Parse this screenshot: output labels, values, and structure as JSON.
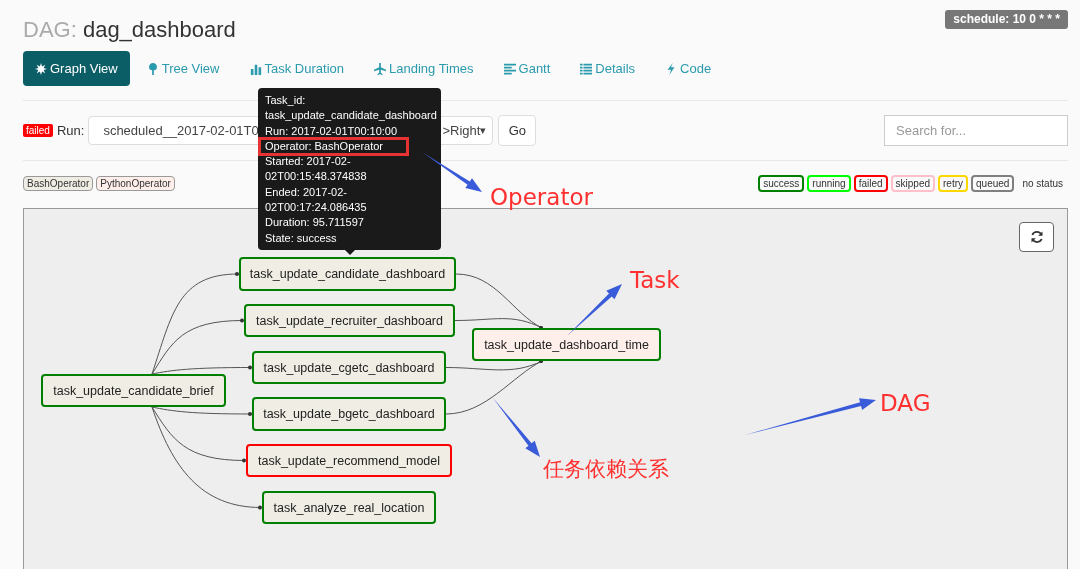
{
  "title": {
    "prefix": "DAG:",
    "name": "dag_dashboard"
  },
  "schedule": "schedule: 10 0 * * *",
  "tabs": [
    {
      "label": "Graph View",
      "selected": true,
      "kind": "burst"
    },
    {
      "label": "Tree View",
      "selected": false,
      "kind": "tree"
    },
    {
      "label": "Task Duration",
      "selected": false,
      "kind": "bars"
    },
    {
      "label": "Landing Times",
      "selected": false,
      "kind": "plane"
    },
    {
      "label": "Gantt",
      "selected": false,
      "kind": "gantt"
    },
    {
      "label": "Details",
      "selected": false,
      "kind": "list"
    },
    {
      "label": "Code",
      "selected": false,
      "kind": "bolt"
    }
  ],
  "run_bar": {
    "status": "failed",
    "label": "Run:",
    "run_value": "scheduled__2017-02-01T0",
    "orientation_value": ">Right",
    "caret": "▾",
    "go": "Go"
  },
  "search": {
    "placeholder": "Search for..."
  },
  "operators": [
    {
      "label": "BashOperator",
      "color": "#f0ede4"
    },
    {
      "label": "PythonOperator",
      "color": "#ffefeb"
    }
  ],
  "legend": [
    {
      "label": "success",
      "color": "#008000"
    },
    {
      "label": "running",
      "color": "#00ff00"
    },
    {
      "label": "failed",
      "color": "#ff0000"
    },
    {
      "label": "skipped",
      "color": "#ffc0cb"
    },
    {
      "label": "retry",
      "color": "#ffd700"
    },
    {
      "label": "queued",
      "color": "#808080"
    },
    {
      "label": "no status",
      "color": "#fafafa"
    }
  ],
  "nodes": [
    {
      "label": "task_update_candidate_dashboard",
      "failed": false,
      "color": "#f0ede4"
    },
    {
      "label": "task_update_recruiter_dashboard",
      "failed": false,
      "color": "#f0ede4"
    },
    {
      "label": "task_update_cgetc_dashboard",
      "failed": false,
      "color": "#f0ede4"
    },
    {
      "label": "task_update_bgetc_dashboard",
      "failed": false,
      "color": "#f0ede4"
    },
    {
      "label": "task_update_recommend_model",
      "failed": true,
      "color": "#f0ede4"
    },
    {
      "label": "task_analyze_real_location",
      "failed": false,
      "color": "#f0ede4"
    },
    {
      "label": "task_update_candidate_brief",
      "failed": false,
      "color": "#f0ede4"
    },
    {
      "label": "task_update_dashboard_time",
      "failed": false,
      "color": "#ffefeb"
    }
  ],
  "tooltip": {
    "lines": [
      {
        "text": "Task_id:",
        "highlighted": false
      },
      {
        "text": "task_update_candidate_dashboard",
        "highlighted": false
      },
      {
        "text": "Run: 2017-02-01T00:10:00",
        "highlighted": false
      },
      {
        "text": "Operator: BashOperator",
        "highlighted": true
      },
      {
        "text": "Started: 2017-02-",
        "highlighted": false
      },
      {
        "text": "02T00:15:48.374838",
        "highlighted": false
      },
      {
        "text": "Ended: 2017-02-",
        "highlighted": false
      },
      {
        "text": "02T00:17:24.086435",
        "highlighted": false
      },
      {
        "text": "Duration: 95.711597",
        "highlighted": false
      },
      {
        "text": "State: success",
        "highlighted": false
      }
    ]
  },
  "annotations": [
    {
      "text": "Operator"
    },
    {
      "text": "Task"
    },
    {
      "text": "任务依赖关系"
    },
    {
      "text": "DAG"
    }
  ]
}
